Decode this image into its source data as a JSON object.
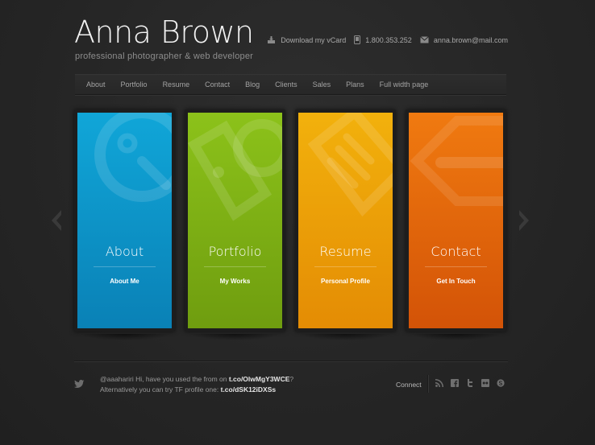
{
  "header": {
    "site_title": "Anna Brown",
    "tagline": "professional photographer & web developer",
    "contacts": [
      {
        "icon": "vcard-download-icon",
        "text": "Download my vCard"
      },
      {
        "icon": "phone-icon",
        "text": "1.800.353.252"
      },
      {
        "icon": "mail-icon",
        "text": "anna.brown@mail.com"
      }
    ]
  },
  "nav": {
    "items": [
      {
        "label": "About"
      },
      {
        "label": "Portfolio"
      },
      {
        "label": "Resume"
      },
      {
        "label": "Contact"
      },
      {
        "label": "Blog"
      },
      {
        "label": "Clients"
      },
      {
        "label": "Sales"
      },
      {
        "label": "Plans"
      },
      {
        "label": "Full width page"
      }
    ]
  },
  "cards": [
    {
      "title": "About",
      "subtitle": "About Me",
      "color_top": "#10a6d8",
      "color_bottom": "#0a81b6",
      "icon": "search-icon"
    },
    {
      "title": "Portfolio",
      "subtitle": "My Works",
      "color_top": "#8cc21a",
      "color_bottom": "#6f9d0f",
      "icon": "tag-icon"
    },
    {
      "title": "Resume",
      "subtitle": "Personal Profile",
      "color_top": "#f2b10c",
      "color_bottom": "#e48c04",
      "icon": "document-icon"
    },
    {
      "title": "Contact",
      "subtitle": "Get In Touch",
      "color_top": "#f07a10",
      "color_bottom": "#d35307",
      "icon": "price-tag-icon"
    }
  ],
  "slider": {
    "prev_icon": "chevron-left-icon",
    "next_icon": "chevron-right-icon"
  },
  "footer": {
    "tweet_prefix": "@aaahariri Hi, have you used the from on ",
    "tweet_link1": "t.co/OlwMgY3WCE",
    "tweet_mid": "?",
    "tweet_line2": "Alternatively you can try TF profile one: ",
    "tweet_link2": "t.co/dSK12iDXSs",
    "connect_label": "Connect",
    "social": [
      "rss-icon",
      "facebook-icon",
      "twitter-icon",
      "flickr-icon",
      "skype-icon"
    ]
  }
}
